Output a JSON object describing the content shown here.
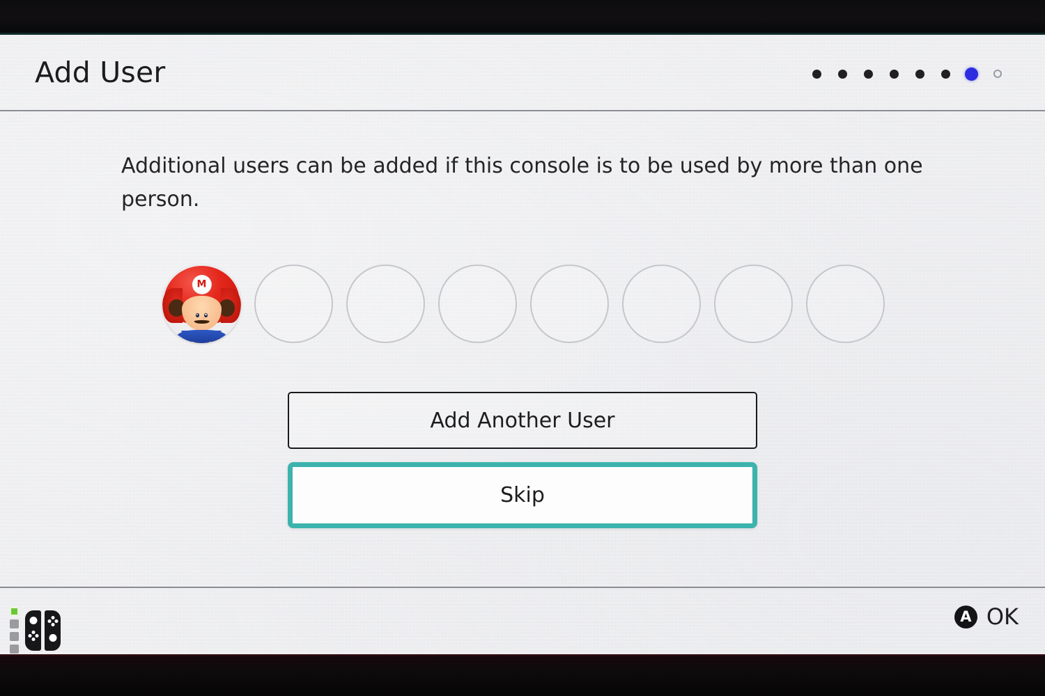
{
  "device": {
    "bezel_color": "#0d0c0e",
    "screen_background": "#efeff1"
  },
  "header": {
    "title": "Add User",
    "pagination": {
      "total_steps": 8,
      "current_step": 7,
      "dots": [
        "done",
        "done",
        "done",
        "done",
        "done",
        "done",
        "current",
        "upcoming"
      ],
      "current_color": "#2c2ce0",
      "done_color": "#221f22",
      "upcoming_color": "#9a9aa0"
    }
  },
  "main": {
    "description": "Additional users can be added if this console is to be used by more than one person.",
    "user_slots": {
      "total": 8,
      "filled_count": 1,
      "items": [
        {
          "state": "filled",
          "avatar": "mario-avatar",
          "emblem_letter": "M"
        },
        {
          "state": "empty"
        },
        {
          "state": "empty"
        },
        {
          "state": "empty"
        },
        {
          "state": "empty"
        },
        {
          "state": "empty"
        },
        {
          "state": "empty"
        },
        {
          "state": "empty"
        }
      ]
    },
    "buttons": {
      "add_another_label": "Add Another User",
      "skip_label": "Skip",
      "selected": "Skip",
      "selection_color": "#3db3ad"
    }
  },
  "footer": {
    "controller": {
      "player_leds": [
        "on",
        "off",
        "off",
        "off"
      ],
      "led_on_color": "#6dc637",
      "led_off_color": "#9b9b9f",
      "joycon_left_icon": "joycon-left-icon",
      "joycon_right_icon": "joycon-right-icon"
    },
    "hint": {
      "button_glyph": "A",
      "label": "OK"
    }
  }
}
